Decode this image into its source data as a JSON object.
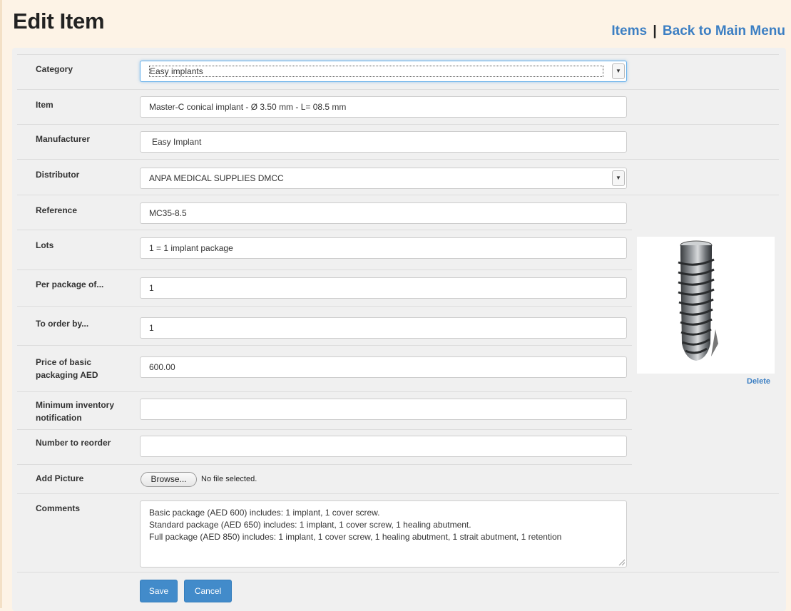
{
  "header": {
    "title": "Edit Item",
    "nav_items": "Items",
    "nav_sep": "|",
    "nav_back": "Back to Main Menu"
  },
  "form": {
    "category": {
      "label": "Category",
      "value": "Easy implants"
    },
    "item": {
      "label": "Item",
      "value": "Master-C conical implant - Ø 3.50 mm - L= 08.5 mm"
    },
    "manufacturer": {
      "label": "Manufacturer",
      "value": "Easy Implant"
    },
    "distributor": {
      "label": "Distributor",
      "value": "ANPA MEDICAL SUPPLIES DMCC"
    },
    "reference": {
      "label": "Reference",
      "value": "MC35-8.5"
    },
    "lots": {
      "label": "Lots",
      "value": "1 = 1 implant package"
    },
    "per_package": {
      "label": "Per package of...",
      "value": "1"
    },
    "order_by": {
      "label": "To order by...",
      "value": "1"
    },
    "price": {
      "label_line1": "Price of basic",
      "label_line2": "packaging AED",
      "value": "600.00"
    },
    "min_inventory": {
      "label_line1": "Minimum inventory",
      "label_line2": "notification",
      "value": ""
    },
    "reorder": {
      "label": "Number to reorder",
      "value": ""
    },
    "picture": {
      "label": "Add Picture",
      "browse_label": "Browse...",
      "status": "No file selected."
    },
    "comments": {
      "label": "Comments",
      "line1": "Basic package (AED 600) includes: 1 implant, 1 cover screw.",
      "line2": "Standard package (AED 650) includes: 1 implant, 1 cover screw, 1 healing abutment.",
      "line3": "Full package (AED 850)  includes: 1 implant, 1 cover screw, 1 healing abutment, 1 strait abutment, 1 retention"
    }
  },
  "image_panel": {
    "delete_label": "Delete"
  },
  "actions": {
    "save_label": "Save",
    "cancel_label": "Cancel"
  },
  "colors": {
    "accent": "#428bca",
    "link": "#3c7fc3",
    "page_bg": "#fdf3e6",
    "panel_bg": "#f0f0f0"
  },
  "icons": {
    "select_arrow": "dropdown-arrow-icon",
    "implant_image": "dental-implant-icon",
    "resize": "resize-grip-icon"
  }
}
